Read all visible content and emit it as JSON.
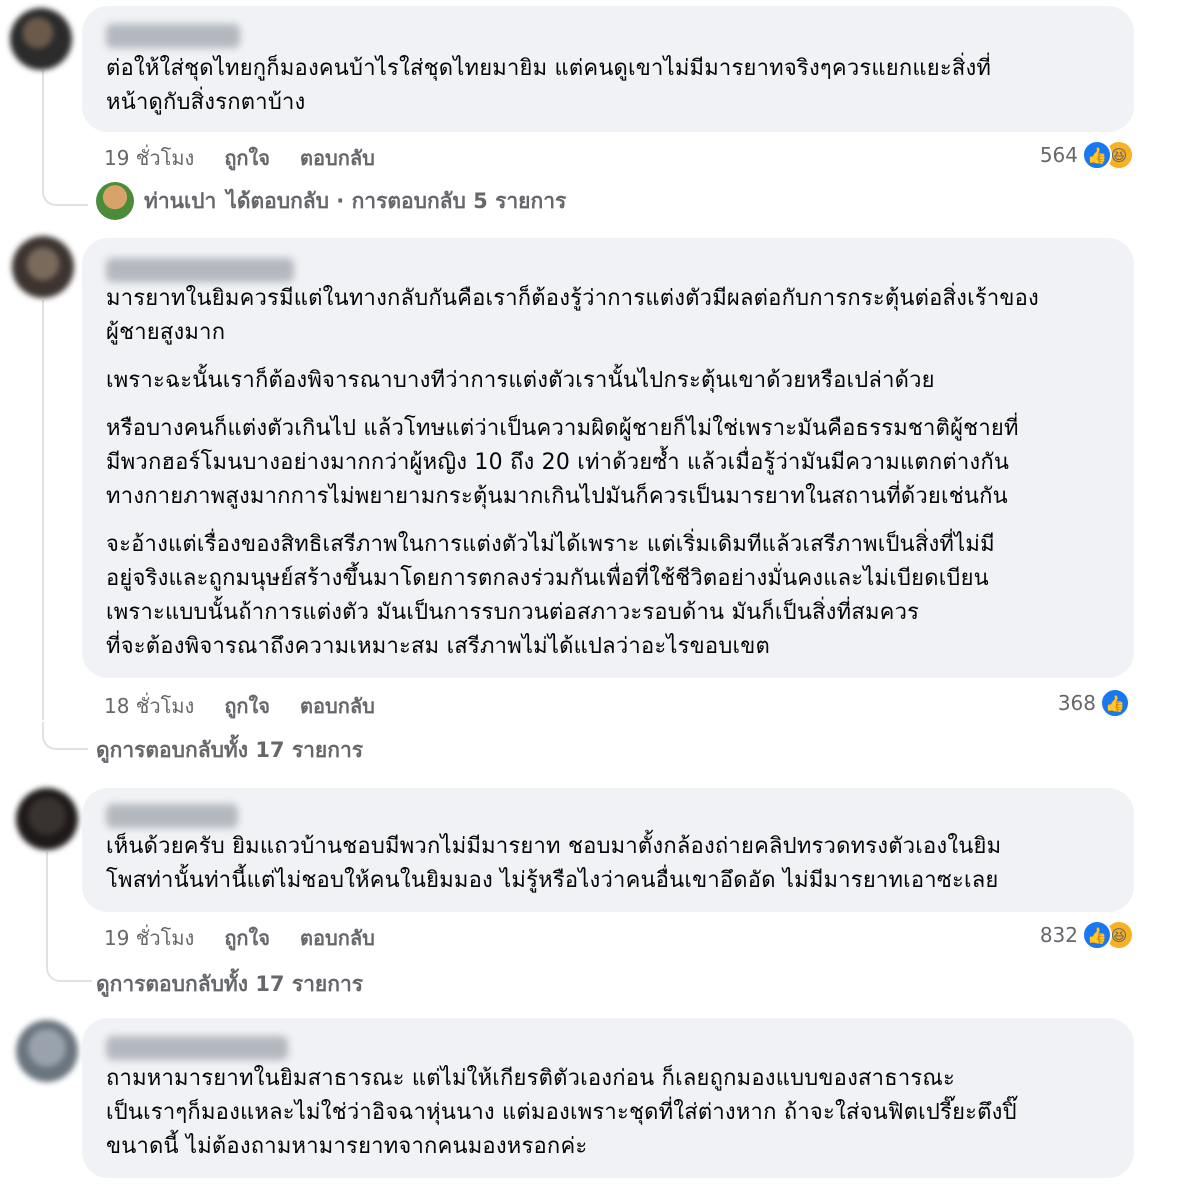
{
  "comments": [
    {
      "lines": [
        "ต่อให้ใส่ชุดไทยกูก็มองคนบ้าไรใส่ชุดไทยมายิม แต่คนดูเขาไม่มีมารยาทจริงๆควรแยกแยะสิ่งที่",
        "หน้าดูกับสิ่งรกตาบ้าง"
      ],
      "time": "19 ชั่วโมง",
      "like_label": "ถูกใจ",
      "reply_label": "ตอบกลับ",
      "reaction_count": "564",
      "reactions": [
        "like-icon",
        "haha-icon"
      ],
      "reply_summary": {
        "author": "ท่านเปา",
        "text": "ได้ตอบกลับ · การตอบกลับ 5 รายการ"
      }
    },
    {
      "paragraphs": [
        [
          "มารยาทในยิมควรมีแต่ในทางกลับกันคือเราก็ต้องรู้ว่าการแต่งตัวมีผลต่อกับการกระตุ้นต่อสิ่งเร้าของ",
          "ผู้ชายสูงมาก"
        ],
        [
          "เพราะฉะนั้นเราก็ต้องพิจารณาบางทีว่าการแต่งตัวเรานั้นไปกระตุ้นเขาด้วยหรือเปล่าด้วย"
        ],
        [
          "หรือบางคนก็แต่งตัวเกินไป แล้วโทษแต่ว่าเป็นความผิดผู้ชายก็ไม่ใช่เพราะมันคือธรรมชาติผู้ชายที่",
          "มีพวกฮอร์โมนบางอย่างมากกว่าผู้หญิง 10 ถึง 20 เท่าด้วยซ้ำ￼ แล้วเมื่อรู้ว่ามันมีความแตกต่างกัน",
          "ทางกายภาพสูงมากการไม่พยายามกระตุ้นมากเกินไปมันก็ควรเป็นมารยาทในสถานที่ด้วยเช่นกัน"
        ],
        [
          "จะอ้างแต่เรื่องของสิทธิเสรีภาพในการแต่งตัวไม่ได้เพราะ แต่เริ่มเดิมที￼แล้วเสรีภาพเป็นสิ่งที่ไม่มี",
          "อยู่จริงและถูกมนุษย์สร้างขึ้นมาโดยการตกลงร่วมกันเพื่อที่ใช้ชีวิตอย่างมั่นคงและไม่เบียดเบียน",
          "เพราะแบบนั้นถ้าการแต่งตัว ￼มันเป็นการรบกวนต่อสภาวะรอบด้าน￼￼￼ มันก็เป็นสิ่งที่สมควร",
          "ที่จะต้องพิจารณาถึงความเหมาะสม เสรีภาพไม่ได้แปลว่าอะไรขอบเขต ￼"
        ]
      ],
      "time": "18 ชั่วโมง",
      "like_label": "ถูกใจ",
      "reply_label": "ตอบกลับ",
      "reaction_count": "368",
      "reactions": [
        "like-icon"
      ],
      "view_replies": "ดูการตอบกลับทั้ง 17 รายการ"
    },
    {
      "lines": [
        "เห็นด้วยครับ ยิมแถวบ้านชอบมีพวกไม่มีมารยาท ชอบมาตั้งกล้องถ่ายคลิปทรวดทรงตัวเองในยิม",
        "โพสท่านั้นท่านี้แต่ไม่ชอบให้คนในยิมมอง ไม่รู้หรือไงว่าคนอื่นเขาอึดอัด ไม่มีมารยาทเอาซะเลย"
      ],
      "time": "19 ชั่วโมง",
      "like_label": "ถูกใจ",
      "reply_label": "ตอบกลับ",
      "reaction_count": "832",
      "reactions": [
        "like-icon",
        "haha-icon"
      ],
      "view_replies": "ดูการตอบกลับทั้ง 17 รายการ"
    },
    {
      "lines": [
        "ถามหามารยาทในยิมสาธารณะ แต่ไม่ให้เกียรติตัวเองก่อน ก็เลยถูกมองแบบของสาธารณะ",
        "เป็นเราๆก็มองแหละไม่ใช่ว่าอิจฉาหุ่นนาง แต่มองเพราะชุดที่ใส่ต่างหาก ถ้าจะใส่จนฟิตเปรี๊ยะตึงปิ๊",
        "ขนาดนี้ ไม่ต้องถามหามารยาทจากคนมองหรอกค่ะ"
      ]
    }
  ],
  "colors": {
    "bubble": "#f0f2f5",
    "meta_text": "#65676b",
    "like_blue": "#1877f2",
    "haha_yellow": "#f7b125"
  }
}
